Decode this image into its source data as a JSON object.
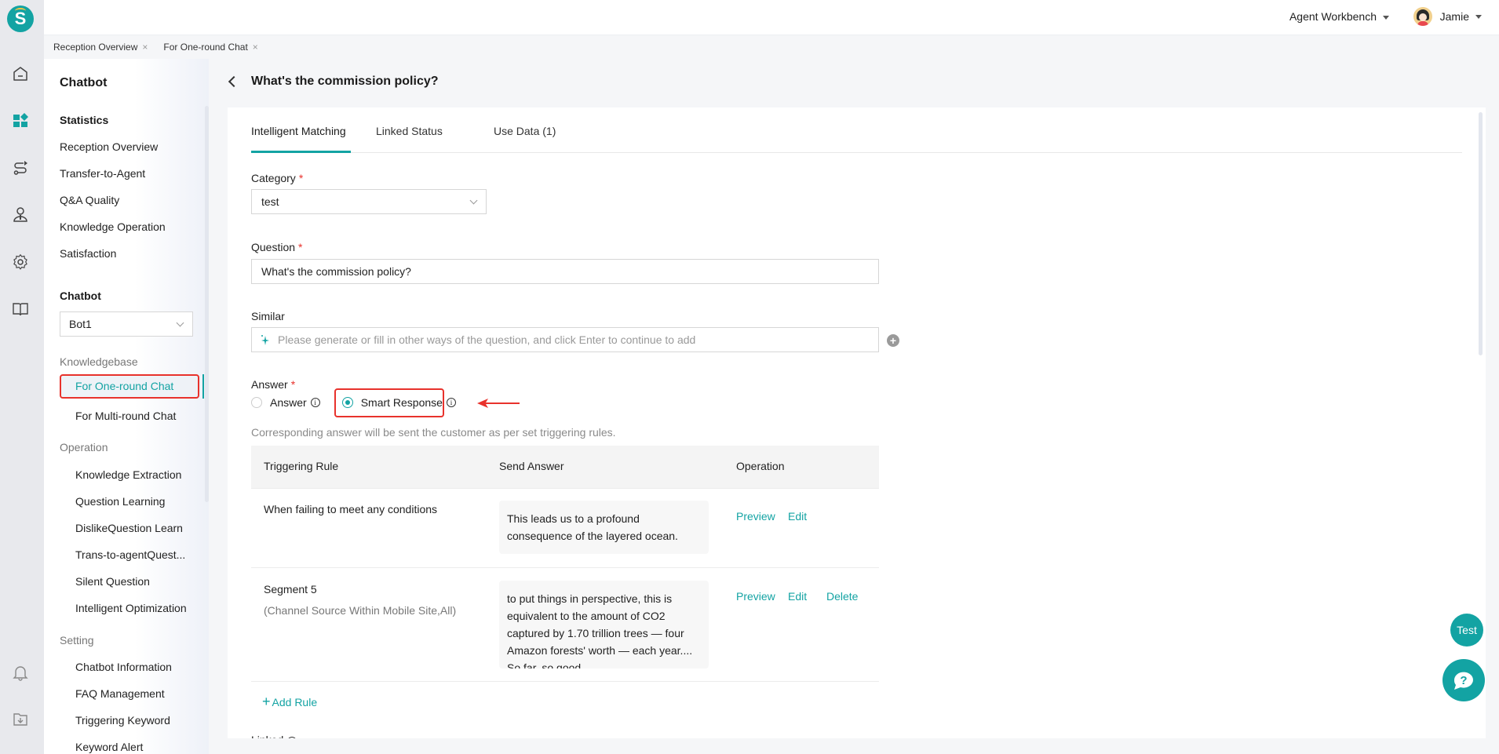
{
  "app": {
    "logo_letter": "S",
    "accent_color": "#13a3a3",
    "highlight_color": "#e8322c"
  },
  "topbar": {
    "workbench_label": "Agent Workbench",
    "user_name": "Jamie"
  },
  "rail": {
    "icons": [
      "home-icon",
      "dashboard-icon",
      "route-icon",
      "agent-icon",
      "settings-icon",
      "book-icon",
      "bell-icon",
      "download-folder-icon"
    ]
  },
  "page_tabs": [
    {
      "label": "Reception Overview",
      "close": "×"
    },
    {
      "label": "For One-round Chat",
      "close": "×"
    }
  ],
  "sidebar": {
    "title": "Chatbot",
    "statistics": {
      "heading": "Statistics",
      "items": [
        "Reception Overview",
        "Transfer-to-Agent",
        "Q&A Quality",
        "Knowledge Operation",
        "Satisfaction"
      ]
    },
    "chatbot": {
      "heading": "Chatbot",
      "selected_bot": "Bot1"
    },
    "knowledgebase": {
      "heading": "Knowledgebase",
      "items": [
        "For One-round Chat",
        "For Multi-round Chat"
      ],
      "active": "For One-round Chat"
    },
    "operation": {
      "heading": "Operation",
      "items": [
        "Knowledge Extraction",
        "Question Learning",
        "DislikeQuestion Learn",
        "Trans-to-agentQuest...",
        "Silent Question",
        "Intelligent Optimization"
      ]
    },
    "setting": {
      "heading": "Setting",
      "items": [
        "Chatbot Information",
        "FAQ Management",
        "Triggering Keyword",
        "Keyword Alert"
      ]
    }
  },
  "main": {
    "title": "What's the commission policy?",
    "tabs": [
      {
        "label": "Intelligent Matching",
        "active": true
      },
      {
        "label": "Linked Status",
        "active": false
      },
      {
        "label": "Use Data (1)",
        "active": false
      }
    ],
    "form": {
      "category_label": "Category",
      "category_value": "test",
      "question_label": "Question",
      "question_value": "What's the commission policy?",
      "similar_label": "Similar",
      "similar_placeholder": "Please generate or fill in other ways of the question, and click Enter to continue to add",
      "required_mark": "*",
      "answer_label": "Answer",
      "answer_options": [
        {
          "label": "Answer",
          "selected": false
        },
        {
          "label": "Smart Response",
          "selected": true
        }
      ],
      "hint": "Corresponding answer will be sent the customer as per set triggering rules."
    },
    "rules_table": {
      "headers": [
        "Triggering Rule",
        "Send Answer",
        "Operation"
      ],
      "rows": [
        {
          "rule": "When failing to meet any conditions",
          "rule_sub": "",
          "answer": "This leads us to a profound consequence of the layered ocean.",
          "operations": [
            "Preview",
            "Edit"
          ]
        },
        {
          "rule": "Segment 5",
          "rule_sub": "(Channel Source Within Mobile Site,All)",
          "answer": "to put things in perspective, this is equivalent to the amount of CO2 captured by 1.70 trillion trees — four Amazon forests' worth — each year.... So far, so good",
          "operations": [
            "Preview",
            "Edit",
            "Delete"
          ]
        }
      ],
      "add_rule_label": "Add Rule"
    },
    "linked_label": "Linked"
  },
  "floating": {
    "test_label": "Test",
    "help_icon": "help-chat-icon"
  }
}
